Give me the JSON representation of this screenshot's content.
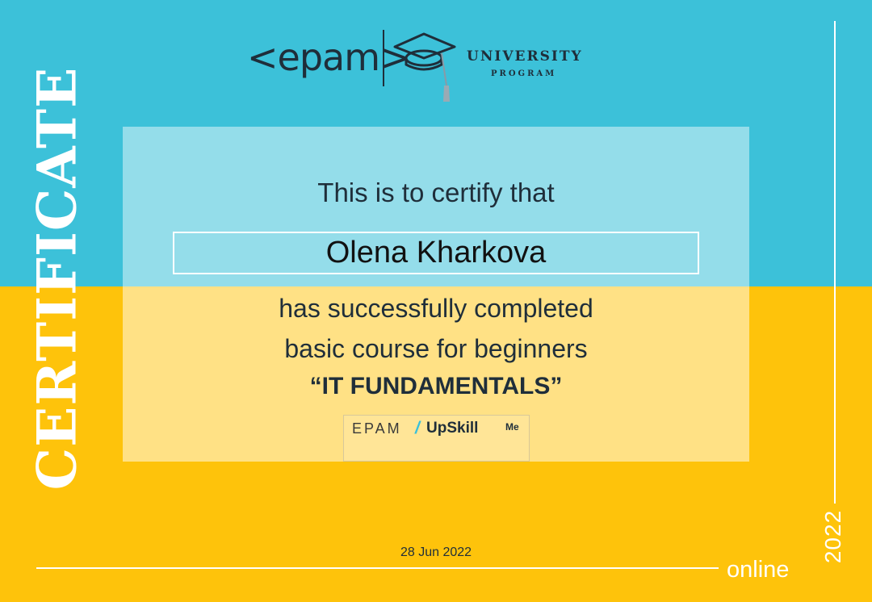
{
  "certificate": {
    "side_title": "CERTIFICATE",
    "logo": {
      "epam": "<epam>",
      "university": "UNIVERSITY",
      "program": "PROGRAM"
    },
    "certify_text": "This is to certify that",
    "recipient_name": "Olena Kharkova",
    "line1": "has successfully completed",
    "line2": "basic course for beginners",
    "course_title": "“IT FUNDAMENTALS”",
    "badge": {
      "epam": "EPAM",
      "slash": "/",
      "upskill": "UpSkill",
      "me": "Me"
    },
    "date": "28 Jun 2022",
    "mode": "online",
    "year": "2022"
  },
  "colors": {
    "top_blue": "#3cc1d9",
    "bottom_yellow": "#fec30b",
    "accent_cyan": "#39c0da",
    "text_dark": "#1f2e3a"
  },
  "icons": [
    "graduation-cap-icon"
  ]
}
